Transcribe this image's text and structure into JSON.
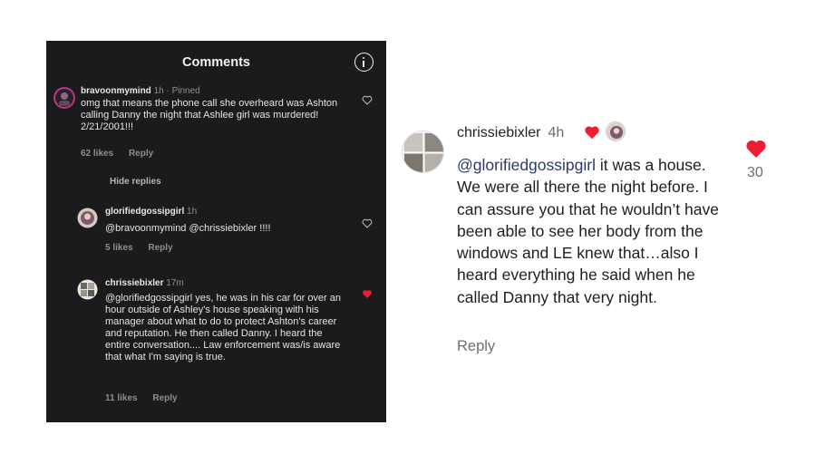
{
  "panel": {
    "title": "Comments",
    "hide_replies": "Hide replies",
    "comments": [
      {
        "username": "bravoonmymind",
        "meta": "1h · Pinned",
        "text": "omg that means the phone call she overheard was Ashton calling Danny the night that Ashlee girl was murdered! 2/21/2001!!!",
        "likes": "62 likes",
        "reply": "Reply",
        "liked": false
      },
      {
        "username": "glorifiedgossipgirl",
        "meta": "1h",
        "text": "@bravoonmymind @chrissiebixler !!!!",
        "likes": "5 likes",
        "reply": "Reply",
        "liked": false
      },
      {
        "username": "chrissiebixler",
        "meta": "17m",
        "text": "@glorifiedgossipgirl yes, he was in his car for over an hour outside of Ashley's house speaking with his manager about what to do to protect Ashton's career and reputation. He then called Danny. I heard the entire conversation.... Law enforcement was/is aware that what I'm saying is true.",
        "likes": "11 likes",
        "reply": "Reply",
        "liked": true
      }
    ]
  },
  "highlight": {
    "username": "chrissiebixler",
    "time": "4h",
    "mention": "@glorifiedgossipgirl",
    "text": " it was a house. We were all there the night before. I can assure you that he wouldn’t have been able to see her body from the windows and LE knew that…also I heard everything he said when he called Danny that very night.",
    "reply": "Reply",
    "likes_count": "30"
  },
  "colors": {
    "panel_bg": "#1b1b1d",
    "heart_red": "#ed1c33",
    "mention_blue": "#283d6b"
  },
  "icons": [
    "info-icon",
    "heart-outline-icon",
    "heart-filled-icon"
  ]
}
